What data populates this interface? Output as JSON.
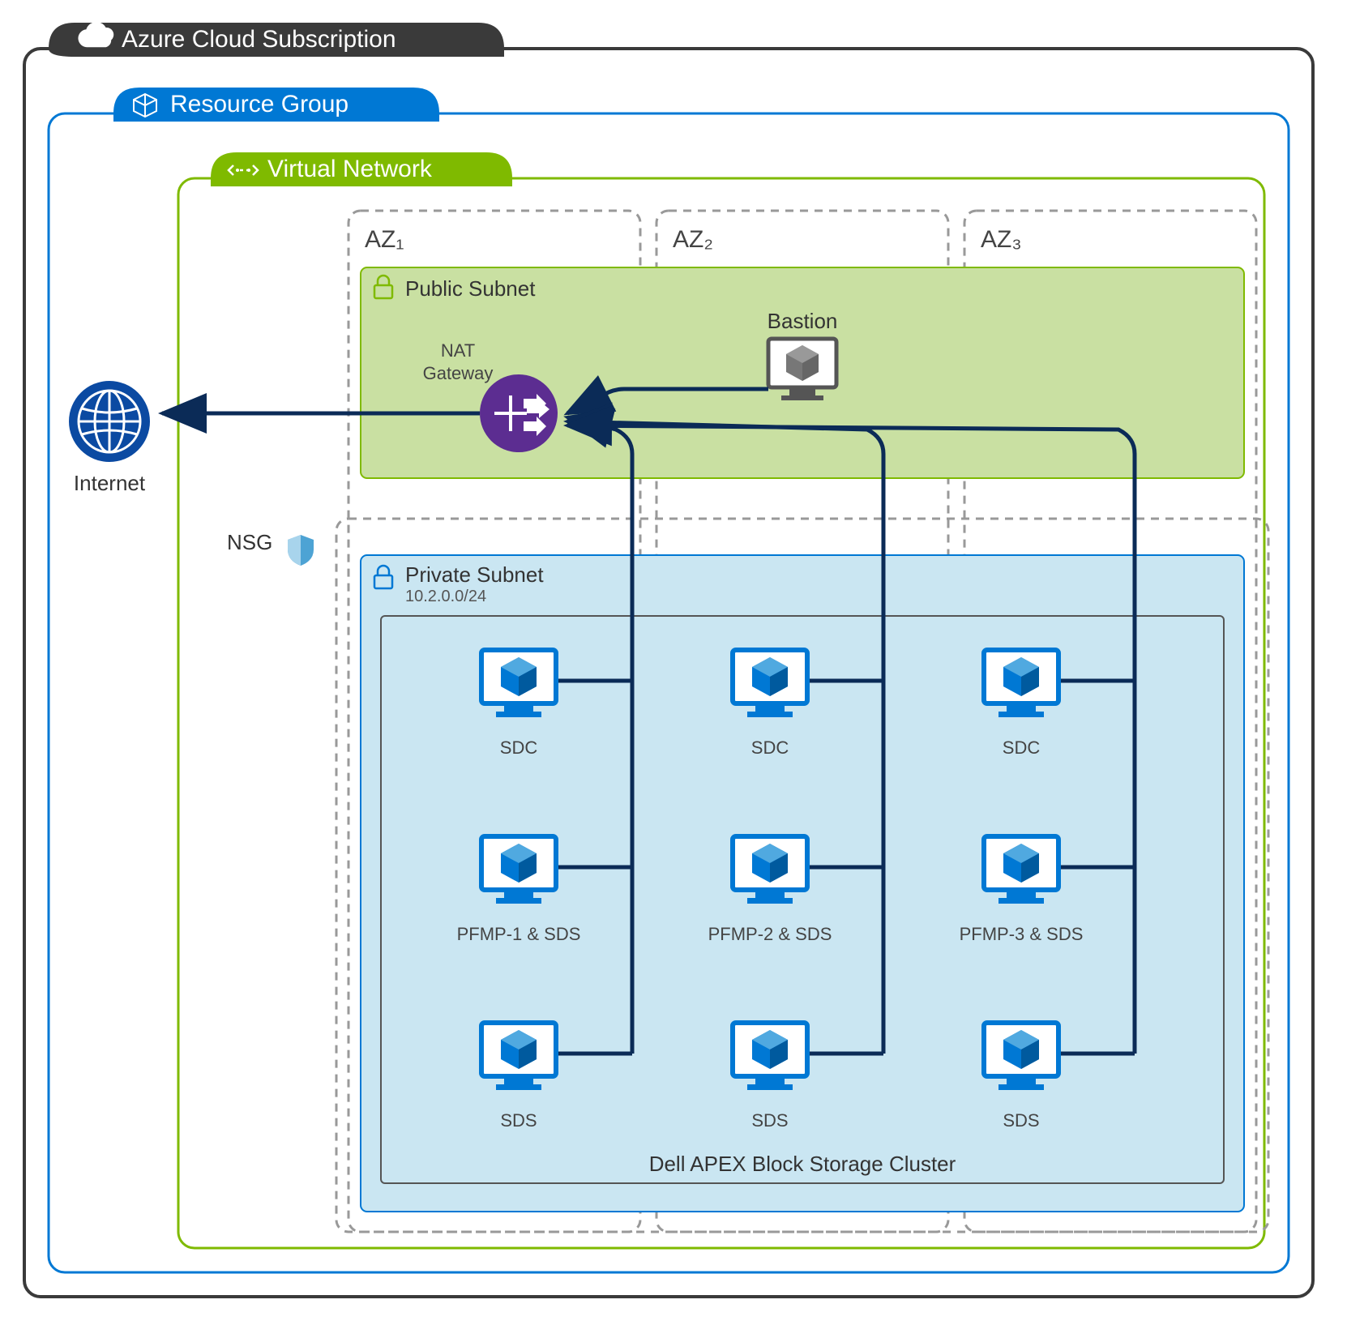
{
  "subscription": {
    "title": "Azure Cloud Subscription"
  },
  "resourceGroup": {
    "title": "Resource Group"
  },
  "vnet": {
    "title": "Virtual Network"
  },
  "internet": {
    "label": "Internet"
  },
  "nsg": {
    "label": "NSG"
  },
  "azs": {
    "az1": "AZ₁",
    "az2": "AZ₂",
    "az3": "AZ₃"
  },
  "publicSubnet": {
    "label": "Public Subnet"
  },
  "natGateway": {
    "label1": "NAT",
    "label2": "Gateway"
  },
  "bastion": {
    "label": "Bastion"
  },
  "privateSubnet": {
    "label": "Private Subnet",
    "cidr": "10.2.0.0/24"
  },
  "cluster": {
    "label": "Dell APEX Block Storage Cluster"
  },
  "nodes": {
    "row1": {
      "c1": "SDC",
      "c2": "SDC",
      "c3": "SDC"
    },
    "row2": {
      "c1": "PFMP-1 & SDS",
      "c2": "PFMP-2 & SDS",
      "c3": "PFMP-3 & SDS"
    },
    "row3": {
      "c1": "SDS",
      "c2": "SDS",
      "c3": "SDS"
    }
  },
  "colors": {
    "dark": "#3a3a3a",
    "blue": "#0078d4",
    "green": "#7fba00",
    "greenFill": "#c9e0a2",
    "lightBlue": "#b3d9ed",
    "navy": "#0b2b57",
    "purple": "#5c2d91",
    "vmBlue": "#0078d4",
    "gray": "#999"
  }
}
